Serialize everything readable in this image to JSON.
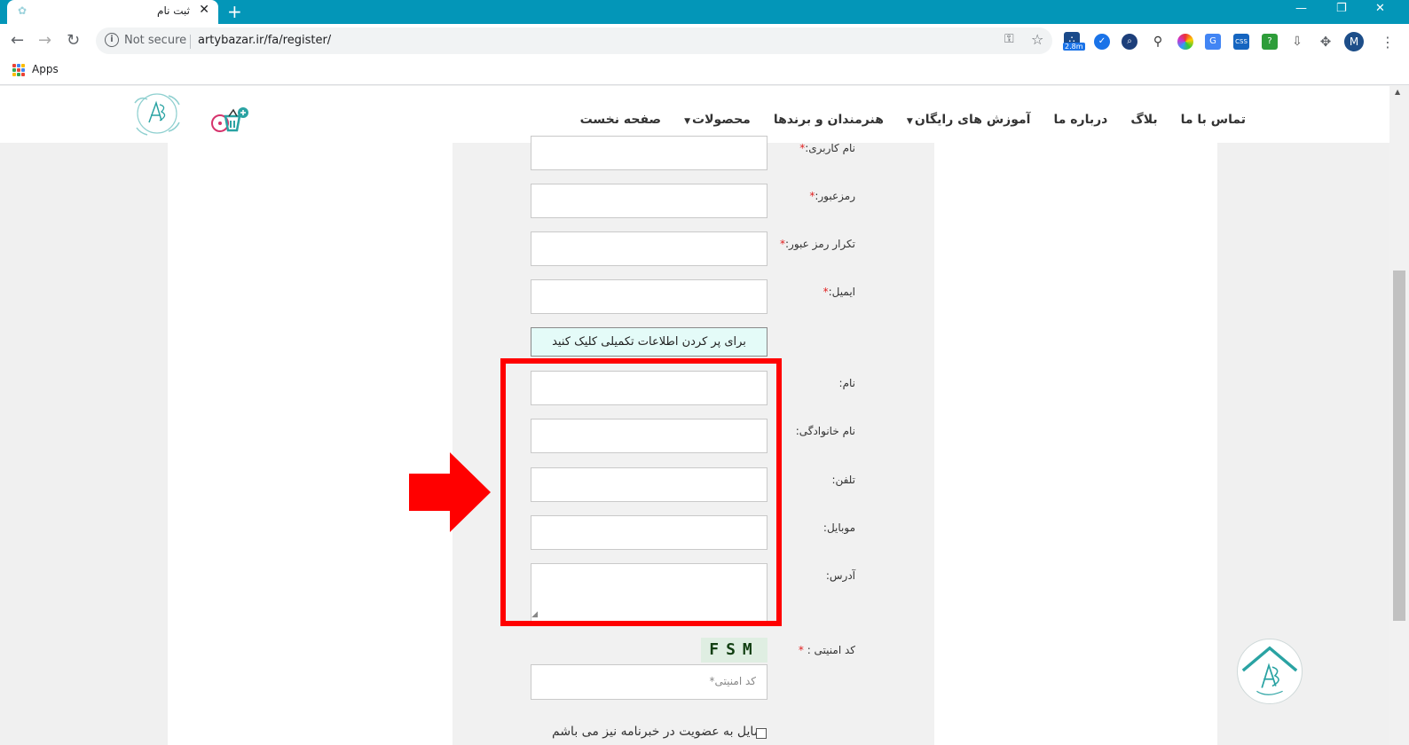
{
  "browser": {
    "tab_title": "ثبت نام",
    "security_label": "Not secure",
    "url": "artybazar.ir/fa/register/",
    "ext_badge": "2.8m",
    "profile_initial": "M",
    "bookmarks": {
      "apps_label": "Apps"
    }
  },
  "site": {
    "menu": [
      {
        "label": "صفحه نخست",
        "dropdown": false
      },
      {
        "label": "محصولات",
        "dropdown": true
      },
      {
        "label": "هنرمندان و برندها",
        "dropdown": false
      },
      {
        "label": "آموزش های رایگان",
        "dropdown": true
      },
      {
        "label": "درباره ما",
        "dropdown": false
      },
      {
        "label": "بلاگ",
        "dropdown": false
      },
      {
        "label": "تماس با ما",
        "dropdown": false
      }
    ]
  },
  "form": {
    "username_label": "نام کاربری:",
    "password_label": "رمزعبور:",
    "password_repeat_label": "تکرار رمز عبور:",
    "email_label": "ایمیل:",
    "required_mark": "*",
    "expand_button": "برای پر کردن اطلاعات تکمیلی کلیک کنید",
    "first_name_label": "نام:",
    "last_name_label": "نام خانوادگی:",
    "phone_label": "تلفن:",
    "mobile_label": "موبایل:",
    "address_label": "آدرس:",
    "captcha_label": "کد امنیتی : ",
    "captcha_text": "FSM",
    "captcha_placeholder": "کد امنیتی*",
    "newsletter_label": "مایل به عضویت در خبرنامه نیز می باشم"
  },
  "colors": {
    "chrome_blue": "#0396b8",
    "highlight_red": "#ff0000",
    "expand_bg": "#e4fbf8",
    "brand_teal": "#2aa3a3"
  }
}
